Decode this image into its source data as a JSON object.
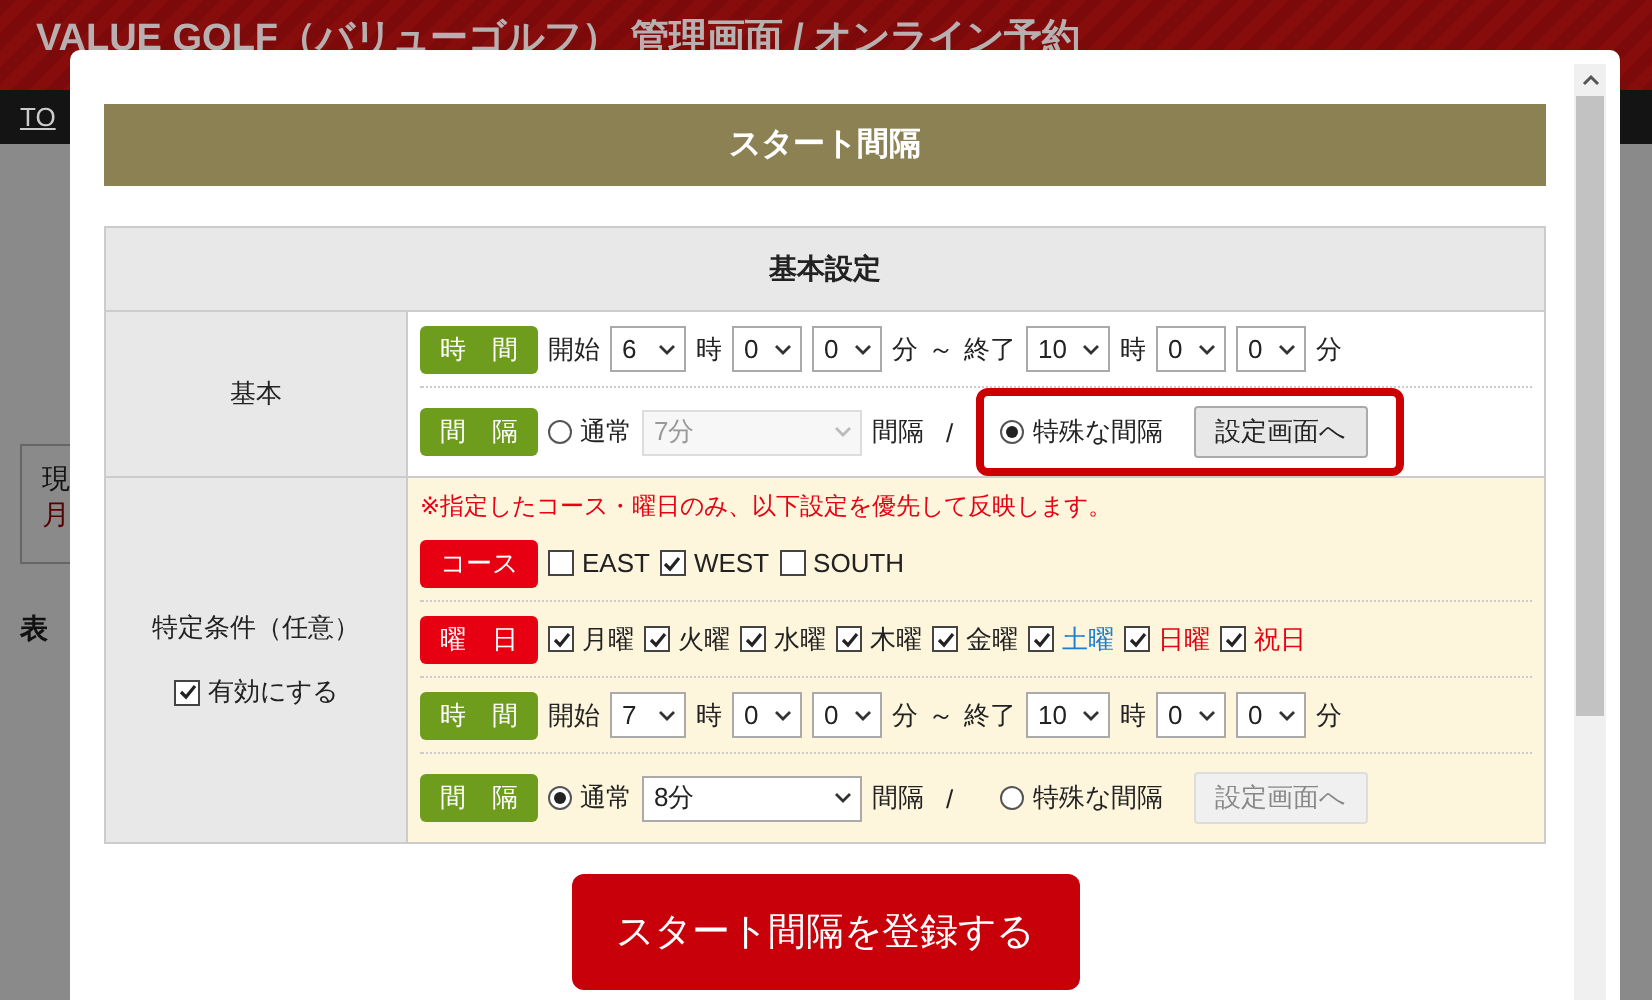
{
  "background": {
    "title": "VALUE GOLF（バリューゴルフ） 管理画面 / オンライン予約",
    "nav_link": "TO",
    "fragments": [
      "現",
      "月",
      "表"
    ]
  },
  "modal": {
    "title": "スタート間隔",
    "section_title": "基本設定",
    "basic": {
      "label": "基本",
      "rows": [
        {
          "kind": "time",
          "tag": {
            "text": "時　間",
            "color": "#6e9c1c"
          },
          "start_label": "開始",
          "start_hour": "6",
          "hour_unit": "時",
          "start_min1": "0",
          "start_min2": "0",
          "min_unit": "分",
          "range": "～",
          "end_label": "終了",
          "end_hour": "10",
          "end_hour_unit": "時",
          "end_min1": "0",
          "end_min2": "0",
          "end_min_unit": "分"
        },
        {
          "kind": "interval",
          "tag": {
            "text": "間　隔",
            "color": "#6e9c1c"
          },
          "normal": {
            "label": "通常",
            "selected": false
          },
          "select": {
            "value": "7分",
            "disabled": true
          },
          "unit": "間隔",
          "slash": "/",
          "special": {
            "label": "特殊な間隔",
            "selected": true
          },
          "button": {
            "label": "設定画面へ",
            "disabled": false
          },
          "highlighted": true
        }
      ]
    },
    "special": {
      "label": "特定条件（任意）",
      "enable": {
        "label": "有効にする",
        "checked": true
      },
      "notice": "※指定したコース・曜日のみ、以下設定を優先して反映します。",
      "rows": [
        {
          "kind": "checks",
          "tag": {
            "text": "コース",
            "color": "#e60012"
          },
          "options": [
            {
              "label": "EAST",
              "checked": false,
              "color": "#222222"
            },
            {
              "label": "WEST",
              "checked": true,
              "color": "#222222"
            },
            {
              "label": "SOUTH",
              "checked": false,
              "color": "#222222"
            }
          ]
        },
        {
          "kind": "checks",
          "tag": {
            "text": "曜　日",
            "color": "#e60012"
          },
          "options": [
            {
              "label": "月曜",
              "checked": true,
              "color": "#222222"
            },
            {
              "label": "火曜",
              "checked": true,
              "color": "#222222"
            },
            {
              "label": "水曜",
              "checked": true,
              "color": "#222222"
            },
            {
              "label": "木曜",
              "checked": true,
              "color": "#222222"
            },
            {
              "label": "金曜",
              "checked": true,
              "color": "#222222"
            },
            {
              "label": "土曜",
              "checked": true,
              "color": "#1a7fd4"
            },
            {
              "label": "日曜",
              "checked": true,
              "color": "#e60012"
            },
            {
              "label": "祝日",
              "checked": true,
              "color": "#e60012"
            }
          ]
        },
        {
          "kind": "time",
          "tag": {
            "text": "時　間",
            "color": "#6e9c1c"
          },
          "start_label": "開始",
          "start_hour": "7",
          "hour_unit": "時",
          "start_min1": "0",
          "start_min2": "0",
          "min_unit": "分",
          "range": "～",
          "end_label": "終了",
          "end_hour": "10",
          "end_hour_unit": "時",
          "end_min1": "0",
          "end_min2": "0",
          "end_min_unit": "分"
        },
        {
          "kind": "interval",
          "tag": {
            "text": "間　隔",
            "color": "#6e9c1c"
          },
          "normal": {
            "label": "通常",
            "selected": true
          },
          "select": {
            "value": "8分",
            "disabled": false
          },
          "unit": "間隔",
          "slash": "/",
          "special": {
            "label": "特殊な間隔",
            "selected": false
          },
          "button": {
            "label": "設定画面へ",
            "disabled": true
          },
          "highlighted": false
        }
      ]
    },
    "submit": "スタート間隔を登録する"
  }
}
